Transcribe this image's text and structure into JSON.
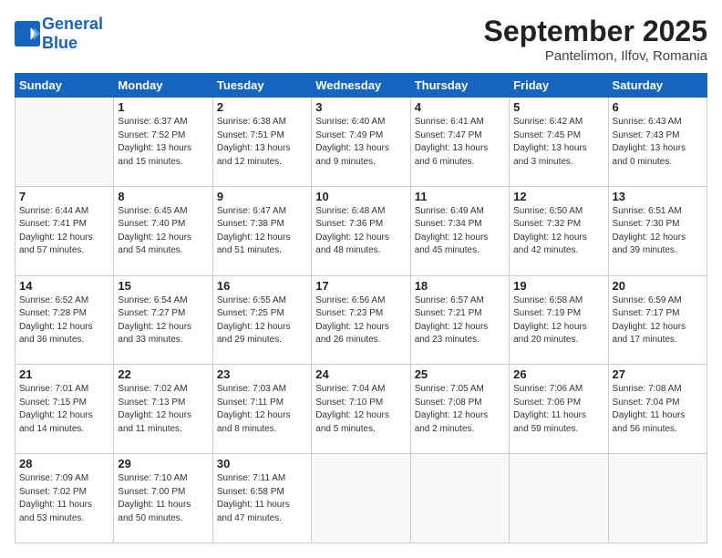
{
  "header": {
    "logo_line1": "General",
    "logo_line2": "Blue",
    "month": "September 2025",
    "location": "Pantelimon, Ilfov, Romania"
  },
  "weekdays": [
    "Sunday",
    "Monday",
    "Tuesday",
    "Wednesday",
    "Thursday",
    "Friday",
    "Saturday"
  ],
  "weeks": [
    [
      {
        "day": "",
        "info": ""
      },
      {
        "day": "1",
        "info": "Sunrise: 6:37 AM\nSunset: 7:52 PM\nDaylight: 13 hours\nand 15 minutes."
      },
      {
        "day": "2",
        "info": "Sunrise: 6:38 AM\nSunset: 7:51 PM\nDaylight: 13 hours\nand 12 minutes."
      },
      {
        "day": "3",
        "info": "Sunrise: 6:40 AM\nSunset: 7:49 PM\nDaylight: 13 hours\nand 9 minutes."
      },
      {
        "day": "4",
        "info": "Sunrise: 6:41 AM\nSunset: 7:47 PM\nDaylight: 13 hours\nand 6 minutes."
      },
      {
        "day": "5",
        "info": "Sunrise: 6:42 AM\nSunset: 7:45 PM\nDaylight: 13 hours\nand 3 minutes."
      },
      {
        "day": "6",
        "info": "Sunrise: 6:43 AM\nSunset: 7:43 PM\nDaylight: 13 hours\nand 0 minutes."
      }
    ],
    [
      {
        "day": "7",
        "info": "Sunrise: 6:44 AM\nSunset: 7:41 PM\nDaylight: 12 hours\nand 57 minutes."
      },
      {
        "day": "8",
        "info": "Sunrise: 6:45 AM\nSunset: 7:40 PM\nDaylight: 12 hours\nand 54 minutes."
      },
      {
        "day": "9",
        "info": "Sunrise: 6:47 AM\nSunset: 7:38 PM\nDaylight: 12 hours\nand 51 minutes."
      },
      {
        "day": "10",
        "info": "Sunrise: 6:48 AM\nSunset: 7:36 PM\nDaylight: 12 hours\nand 48 minutes."
      },
      {
        "day": "11",
        "info": "Sunrise: 6:49 AM\nSunset: 7:34 PM\nDaylight: 12 hours\nand 45 minutes."
      },
      {
        "day": "12",
        "info": "Sunrise: 6:50 AM\nSunset: 7:32 PM\nDaylight: 12 hours\nand 42 minutes."
      },
      {
        "day": "13",
        "info": "Sunrise: 6:51 AM\nSunset: 7:30 PM\nDaylight: 12 hours\nand 39 minutes."
      }
    ],
    [
      {
        "day": "14",
        "info": "Sunrise: 6:52 AM\nSunset: 7:28 PM\nDaylight: 12 hours\nand 36 minutes."
      },
      {
        "day": "15",
        "info": "Sunrise: 6:54 AM\nSunset: 7:27 PM\nDaylight: 12 hours\nand 33 minutes."
      },
      {
        "day": "16",
        "info": "Sunrise: 6:55 AM\nSunset: 7:25 PM\nDaylight: 12 hours\nand 29 minutes."
      },
      {
        "day": "17",
        "info": "Sunrise: 6:56 AM\nSunset: 7:23 PM\nDaylight: 12 hours\nand 26 minutes."
      },
      {
        "day": "18",
        "info": "Sunrise: 6:57 AM\nSunset: 7:21 PM\nDaylight: 12 hours\nand 23 minutes."
      },
      {
        "day": "19",
        "info": "Sunrise: 6:58 AM\nSunset: 7:19 PM\nDaylight: 12 hours\nand 20 minutes."
      },
      {
        "day": "20",
        "info": "Sunrise: 6:59 AM\nSunset: 7:17 PM\nDaylight: 12 hours\nand 17 minutes."
      }
    ],
    [
      {
        "day": "21",
        "info": "Sunrise: 7:01 AM\nSunset: 7:15 PM\nDaylight: 12 hours\nand 14 minutes."
      },
      {
        "day": "22",
        "info": "Sunrise: 7:02 AM\nSunset: 7:13 PM\nDaylight: 12 hours\nand 11 minutes."
      },
      {
        "day": "23",
        "info": "Sunrise: 7:03 AM\nSunset: 7:11 PM\nDaylight: 12 hours\nand 8 minutes."
      },
      {
        "day": "24",
        "info": "Sunrise: 7:04 AM\nSunset: 7:10 PM\nDaylight: 12 hours\nand 5 minutes."
      },
      {
        "day": "25",
        "info": "Sunrise: 7:05 AM\nSunset: 7:08 PM\nDaylight: 12 hours\nand 2 minutes."
      },
      {
        "day": "26",
        "info": "Sunrise: 7:06 AM\nSunset: 7:06 PM\nDaylight: 11 hours\nand 59 minutes."
      },
      {
        "day": "27",
        "info": "Sunrise: 7:08 AM\nSunset: 7:04 PM\nDaylight: 11 hours\nand 56 minutes."
      }
    ],
    [
      {
        "day": "28",
        "info": "Sunrise: 7:09 AM\nSunset: 7:02 PM\nDaylight: 11 hours\nand 53 minutes."
      },
      {
        "day": "29",
        "info": "Sunrise: 7:10 AM\nSunset: 7:00 PM\nDaylight: 11 hours\nand 50 minutes."
      },
      {
        "day": "30",
        "info": "Sunrise: 7:11 AM\nSunset: 6:58 PM\nDaylight: 11 hours\nand 47 minutes."
      },
      {
        "day": "",
        "info": ""
      },
      {
        "day": "",
        "info": ""
      },
      {
        "day": "",
        "info": ""
      },
      {
        "day": "",
        "info": ""
      }
    ]
  ]
}
